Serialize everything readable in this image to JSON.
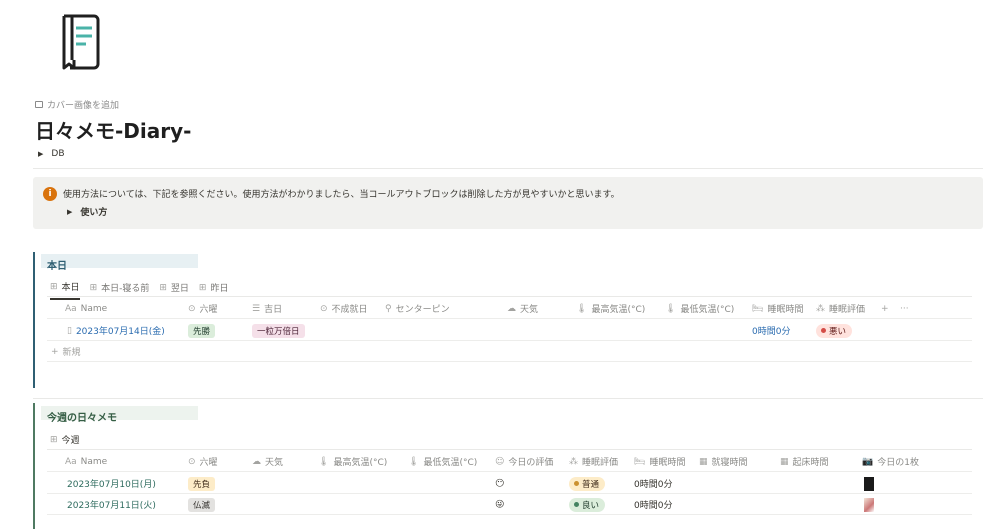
{
  "cover_add": "カバー画像を追加",
  "title": "日々メモ-Diary-",
  "db_toggle": "DB",
  "callout": {
    "text": "使用方法については、下記を参照ください。使用方法がわかりましたら、当コールアウトブロックは削除した方が見やすいかと思います。",
    "toggle": "使い方",
    "icon": "info-icon",
    "color": "#d9730d"
  },
  "today": {
    "title": "本日",
    "tabs": [
      "本日",
      "本日-寝る前",
      "翌日",
      "昨日"
    ],
    "columns": [
      "Name",
      "六曜",
      "吉日",
      "不成就日",
      "センターピン",
      "天気",
      "最高気温(°C)",
      "最低気温(°C)",
      "睡眠時間",
      "睡眠評価"
    ],
    "header_add": "+",
    "header_more": "···",
    "rows": [
      {
        "name": "2023年07月14日(金)",
        "rokuyo": "先勝",
        "kichijitsu": "一粒万倍日",
        "sleep_time": "0時間0分",
        "sleep_eval": "悪い"
      }
    ],
    "new_label": "新規"
  },
  "week": {
    "title": "今週の日々メモ",
    "tabs": [
      "今週"
    ],
    "columns": [
      "Name",
      "六曜",
      "天気",
      "最高気温(°C)",
      "最低気温(°C)",
      "今日の評価",
      "睡眠評価",
      "睡眠時間",
      "就寝時間",
      "起床時間",
      "今日の1枚"
    ],
    "rows": [
      {
        "name": "2023年07月10日(月)",
        "rokuyo": "先負",
        "face": "😶",
        "sleep_eval": "普通",
        "sleep_time": "0時間0分"
      },
      {
        "name": "2023年07月11日(火)",
        "rokuyo": "仏滅",
        "face": "😜",
        "sleep_eval": "良い",
        "sleep_time": "0時間0分"
      }
    ]
  },
  "colors": {
    "accent_today": "#2f5f73",
    "accent_week": "#4f7a62"
  }
}
